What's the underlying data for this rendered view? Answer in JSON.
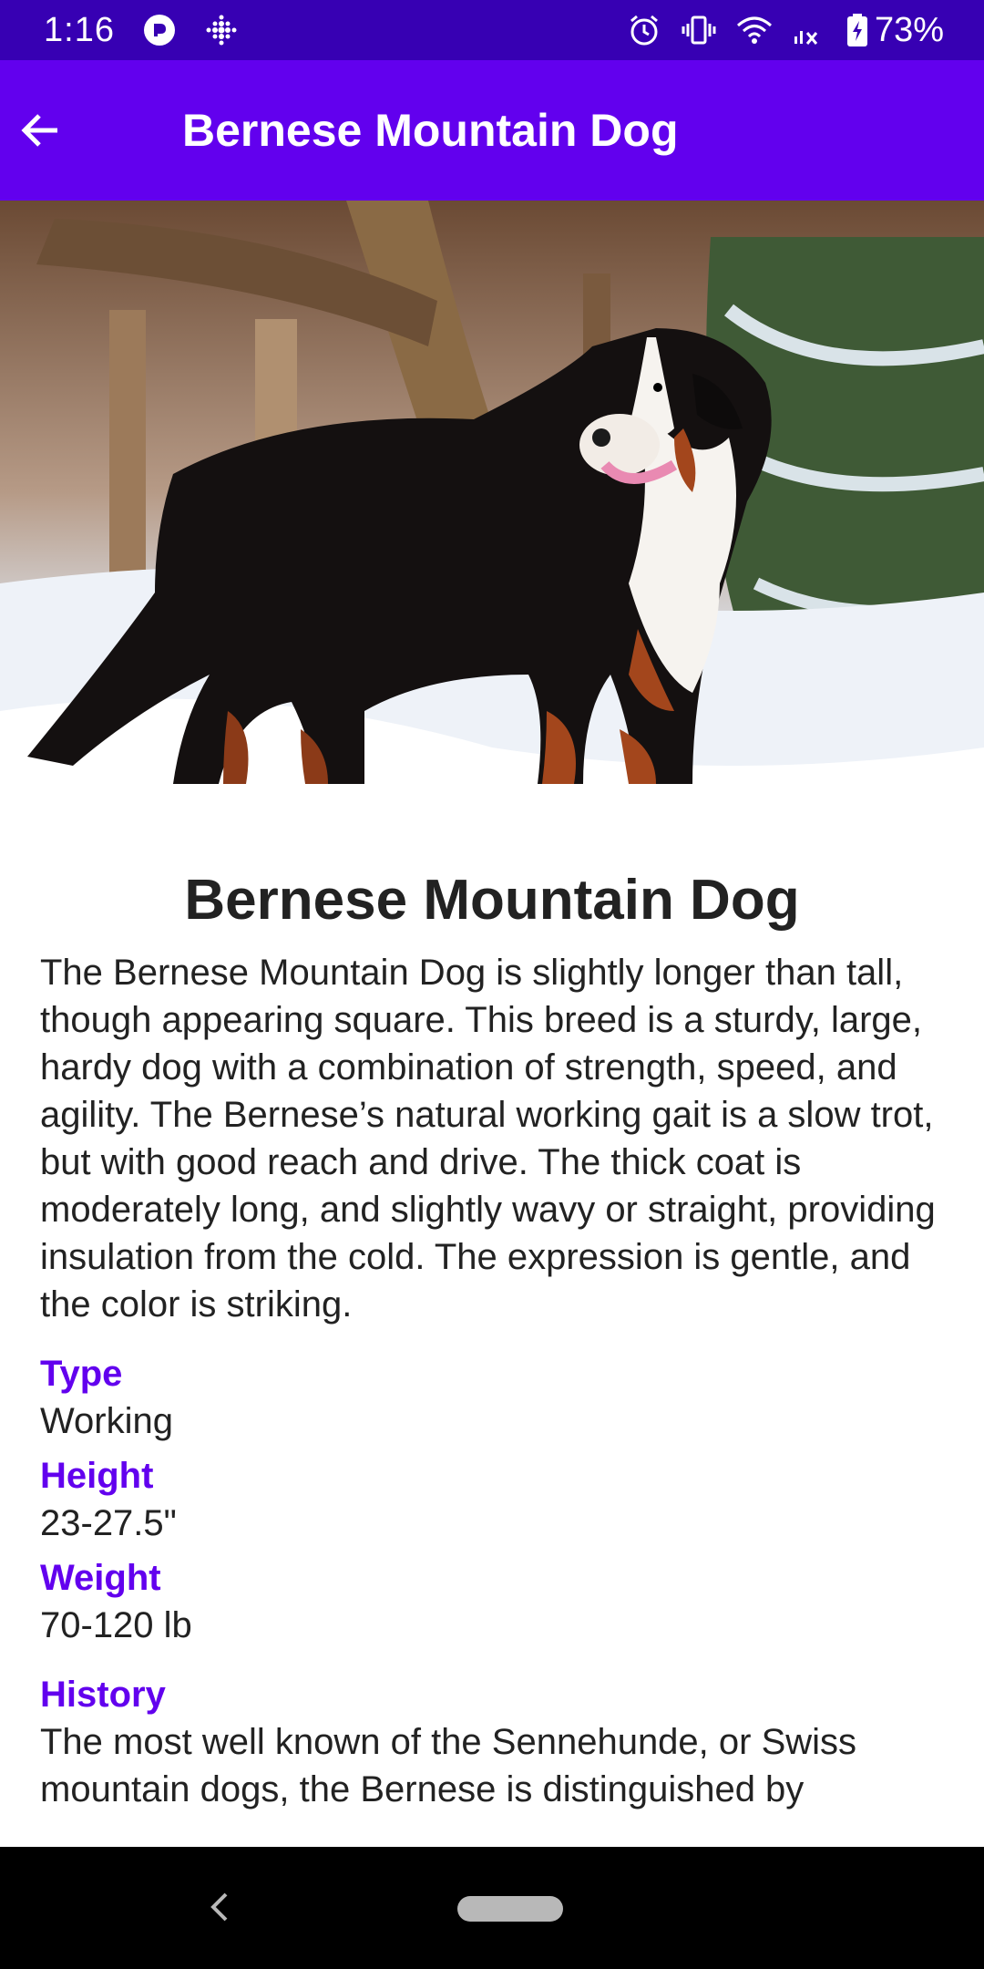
{
  "status_bar": {
    "time": "1:16",
    "battery_percent": "73%",
    "icons": [
      "messenger-icon",
      "fitbit-icon",
      "alarm-icon",
      "vibrate-icon",
      "wifi-icon",
      "signal-icon",
      "battery-charging-icon"
    ]
  },
  "app_bar": {
    "title": "Bernese Mountain Dog",
    "back_icon": "arrow-left-icon"
  },
  "breed": {
    "name": "Bernese Mountain Dog",
    "description": "The Bernese Mountain Dog is slightly longer than tall, though appearing square. This breed is a sturdy, large, hardy dog with a combination of strength, speed, and agility. The Bernese’s natural working gait is a slow trot, but with good reach and drive. The thick coat is moderately long, and slightly wavy or straight, providing insulation from the cold. The expression is gentle, and the color is striking.",
    "type_label": "Type",
    "type_value": "Working",
    "height_label": "Height",
    "height_value": "23-27.5\"",
    "weight_label": "Weight",
    "weight_value": "70-120 lb",
    "history_label": "History",
    "history_value": "The most well known of the Sennehunde, or Swiss mountain dogs, the Bernese is distinguished by"
  },
  "colors": {
    "status_bar": "#3700b3",
    "app_bar": "#6200ee",
    "accent": "#6200ee",
    "text": "#222222"
  }
}
